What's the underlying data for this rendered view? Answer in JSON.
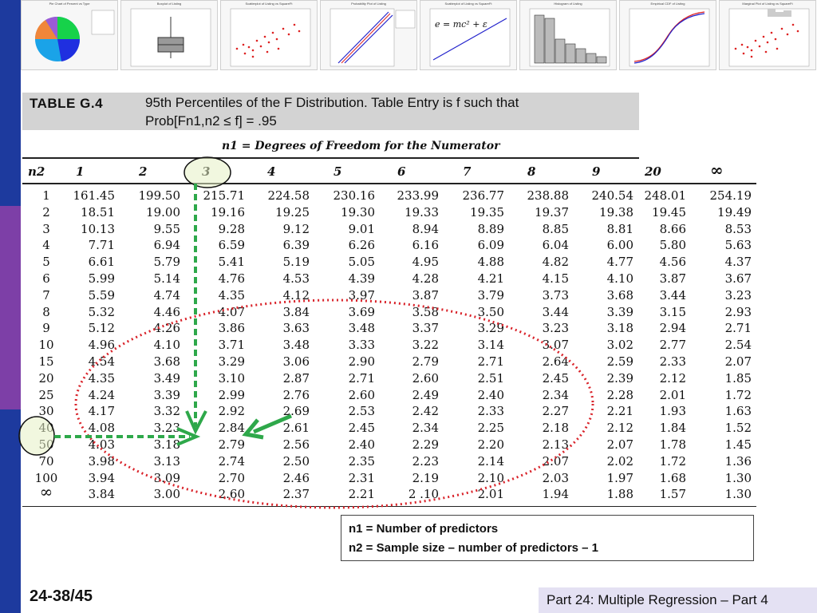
{
  "sidebar": {
    "colors": [
      "#1d3a9e",
      "#7d3fa7",
      "#1d3a9e"
    ]
  },
  "thumbnails": [
    {
      "title": "Pie Chart of Percent vs Type"
    },
    {
      "title": "Boxplot of Listing"
    },
    {
      "title": "Scatterplot of Listing vs SquareFt"
    },
    {
      "title": "Probability Plot of Listing"
    },
    {
      "title": "Scatterplot of Listing vs SquareFt",
      "formula": "e = mc² + ε"
    },
    {
      "title": "Histogram of Listing"
    },
    {
      "title": "Empirical CDF of Listing"
    },
    {
      "title": "Marginal Plot of Listing vs SquareFt"
    }
  ],
  "table": {
    "id": "TABLE G.4",
    "title_line1": "95th Percentiles of the F Distribution. Table Entry is f such that",
    "title_line2": "Prob[Fn1,n2 ≤ f] = .95",
    "n1_caption": "n1 = Degrees of Freedom for the Numerator",
    "n2_label": "n2",
    "columns": [
      "1",
      "2",
      "3",
      "4",
      "5",
      "6",
      "7",
      "8",
      "9",
      "20",
      "∞"
    ],
    "rows": [
      {
        "n2": "1",
        "values": [
          "161.45",
          "199.50",
          "215.71",
          "224.58",
          "230.16",
          "233.99",
          "236.77",
          "238.88",
          "240.54",
          "248.01",
          "254.19"
        ]
      },
      {
        "n2": "2",
        "values": [
          "18.51",
          "19.00",
          "19.16",
          "19.25",
          "19.30",
          "19.33",
          "19.35",
          "19.37",
          "19.38",
          "19.45",
          "19.49"
        ]
      },
      {
        "n2": "3",
        "values": [
          "10.13",
          "9.55",
          "9.28",
          "9.12",
          "9.01",
          "8.94",
          "8.89",
          "8.85",
          "8.81",
          "8.66",
          "8.53"
        ]
      },
      {
        "n2": "4",
        "values": [
          "7.71",
          "6.94",
          "6.59",
          "6.39",
          "6.26",
          "6.16",
          "6.09",
          "6.04",
          "6.00",
          "5.80",
          "5.63"
        ]
      },
      {
        "n2": "5",
        "values": [
          "6.61",
          "5.79",
          "5.41",
          "5.19",
          "5.05",
          "4.95",
          "4.88",
          "4.82",
          "4.77",
          "4.56",
          "4.37"
        ]
      },
      {
        "n2": "6",
        "values": [
          "5.99",
          "5.14",
          "4.76",
          "4.53",
          "4.39",
          "4.28",
          "4.21",
          "4.15",
          "4.10",
          "3.87",
          "3.67"
        ]
      },
      {
        "n2": "7",
        "values": [
          "5.59",
          "4.74",
          "4.35",
          "4.12",
          "3.97",
          "3.87",
          "3.79",
          "3.73",
          "3.68",
          "3.44",
          "3.23"
        ]
      },
      {
        "n2": "8",
        "values": [
          "5.32",
          "4.46",
          "4.07",
          "3.84",
          "3.69",
          "3.58",
          "3.50",
          "3.44",
          "3.39",
          "3.15",
          "2.93"
        ]
      },
      {
        "n2": "9",
        "values": [
          "5.12",
          "4.26",
          "3.86",
          "3.63",
          "3.48",
          "3.37",
          "3.29",
          "3.23",
          "3.18",
          "2.94",
          "2.71"
        ]
      },
      {
        "n2": "10",
        "values": [
          "4.96",
          "4.10",
          "3.71",
          "3.48",
          "3.33",
          "3.22",
          "3.14",
          "3.07",
          "3.02",
          "2.77",
          "2.54"
        ]
      },
      {
        "n2": "15",
        "values": [
          "4.54",
          "3.68",
          "3.29",
          "3.06",
          "2.90",
          "2.79",
          "2.71",
          "2.64",
          "2.59",
          "2.33",
          "2.07"
        ]
      },
      {
        "n2": "20",
        "values": [
          "4.35",
          "3.49",
          "3.10",
          "2.87",
          "2.71",
          "2.60",
          "2.51",
          "2.45",
          "2.39",
          "2.12",
          "1.85"
        ]
      },
      {
        "n2": "25",
        "values": [
          "4.24",
          "3.39",
          "2.99",
          "2.76",
          "2.60",
          "2.49",
          "2.40",
          "2.34",
          "2.28",
          "2.01",
          "1.72"
        ]
      },
      {
        "n2": "30",
        "values": [
          "4.17",
          "3.32",
          "2.92",
          "2.69",
          "2.53",
          "2.42",
          "2.33",
          "2.27",
          "2.21",
          "1.93",
          "1.63"
        ]
      },
      {
        "n2": "40",
        "values": [
          "4.08",
          "3.23",
          "2.84",
          "2.61",
          "2.45",
          "2.34",
          "2.25",
          "2.18",
          "2.12",
          "1.84",
          "1.52"
        ]
      },
      {
        "n2": "50",
        "values": [
          "4.03",
          "3.18",
          "2.79",
          "2.56",
          "2.40",
          "2.29",
          "2.20",
          "2.13",
          "2.07",
          "1.78",
          "1.45"
        ]
      },
      {
        "n2": "70",
        "values": [
          "3.98",
          "3.13",
          "2.74",
          "2.50",
          "2.35",
          "2.23",
          "2.14",
          "2.07",
          "2.02",
          "1.72",
          "1.36"
        ]
      },
      {
        "n2": "100",
        "values": [
          "3.94",
          "3.09",
          "2.70",
          "2.46",
          "2.31",
          "2.19",
          "2.10",
          "2.03",
          "1.97",
          "1.68",
          "1.30"
        ]
      },
      {
        "n2": "∞",
        "values": [
          "3.84",
          "3.00",
          "2.60",
          "2.37",
          "2.21",
          "2 .10",
          "2.01",
          "1.94",
          "1.88",
          "1.57",
          "1.30"
        ]
      }
    ]
  },
  "annotations": {
    "highlight_column": "3",
    "highlight_row": "40",
    "highlight_row_2": "50",
    "target_value": "2.84",
    "circle_fill": "#e6f0c4",
    "dash_color": "#2ea84a",
    "ellipse_color": "#d9232a"
  },
  "legend": {
    "line1": "n1 = Number of predictors",
    "line2": "n2 = Sample size – number of predictors – 1"
  },
  "footer": {
    "slide_number": "24-38/45",
    "caption": "Part 24: Multiple Regression – Part 4"
  }
}
